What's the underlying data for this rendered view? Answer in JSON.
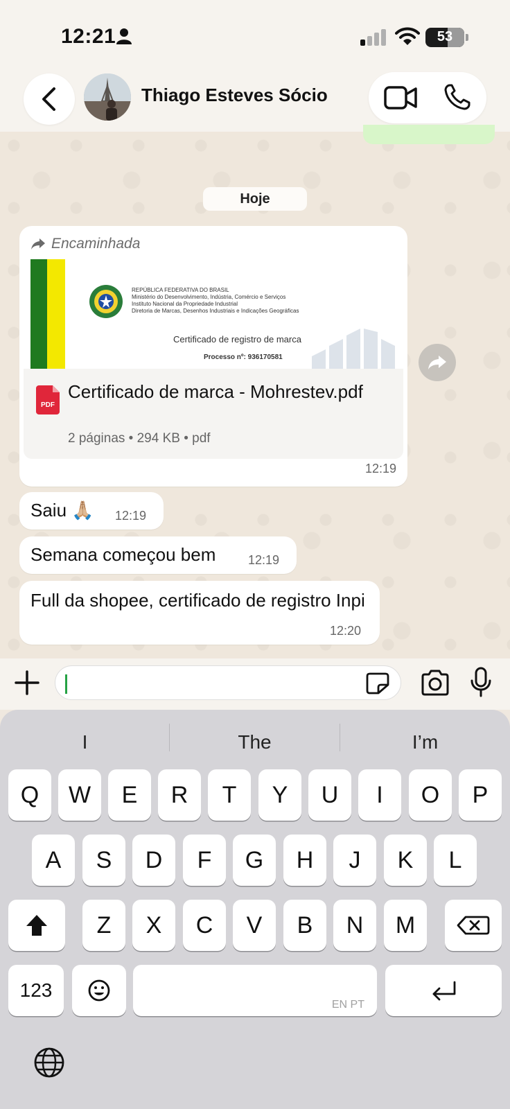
{
  "status_bar": {
    "time": "12:21",
    "battery": "53"
  },
  "header": {
    "contact_name": "Thiago Esteves Sócio"
  },
  "chat": {
    "date_chip": "Hoje",
    "document_message": {
      "forwarded_label": "Encaminhada",
      "preview": {
        "lines": [
          "REPÚBLICA FEDERATIVA DO BRASIL",
          "Ministério do Desenvolvimento, Indústria, Comércio e Serviços",
          "Instituto Nacional da Propriedade Industrial",
          "Diretoria de Marcas, Desenhos Industriais e Indicações Geográficas"
        ],
        "title": "Certificado de registro de marca",
        "process": "Processo nº: 936170581"
      },
      "file_icon_label": "PDF",
      "file_name": "Certificado de marca - Mohrestev.pdf",
      "file_meta": "2 páginas • 294 KB • pdf",
      "time": "12:19"
    },
    "messages": [
      {
        "text": "Saiu 🙏🏼",
        "time": "12:19"
      },
      {
        "text": "Semana começou bem",
        "time": "12:19"
      },
      {
        "text": "Full da shopee, certificado de registro Inpi",
        "time": "12:20"
      }
    ]
  },
  "composer": {
    "input_value": ""
  },
  "keyboard": {
    "suggestions": [
      "I",
      "The",
      "I’m"
    ],
    "row1": [
      "Q",
      "W",
      "E",
      "R",
      "T",
      "Y",
      "U",
      "I",
      "O",
      "P"
    ],
    "row2": [
      "A",
      "S",
      "D",
      "F",
      "G",
      "H",
      "J",
      "K",
      "L"
    ],
    "row3": [
      "Z",
      "X",
      "C",
      "V",
      "B",
      "N",
      "M"
    ],
    "numbers_key": "123",
    "space_hint": "EN PT"
  },
  "colors": {
    "accent_green": "#25a244",
    "sent_bubble": "#d8f6c9",
    "pdf_red": "#e0263a"
  }
}
